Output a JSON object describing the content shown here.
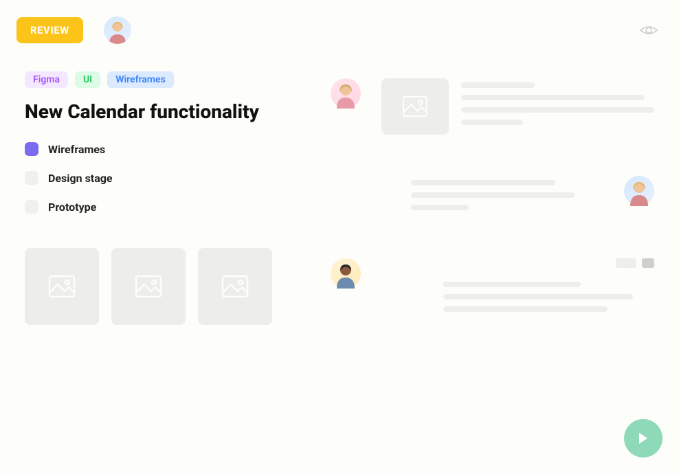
{
  "header": {
    "review_label": "REVIEW"
  },
  "tags": [
    {
      "label": "Figma",
      "style": "purple"
    },
    {
      "label": "UI",
      "style": "green"
    },
    {
      "label": "Wireframes",
      "style": "blue"
    }
  ],
  "title": "New Calendar functionality",
  "stages": [
    {
      "label": "Wireframes",
      "active": true
    },
    {
      "label": "Design stage",
      "active": false
    },
    {
      "label": "Prototype",
      "active": false
    }
  ]
}
